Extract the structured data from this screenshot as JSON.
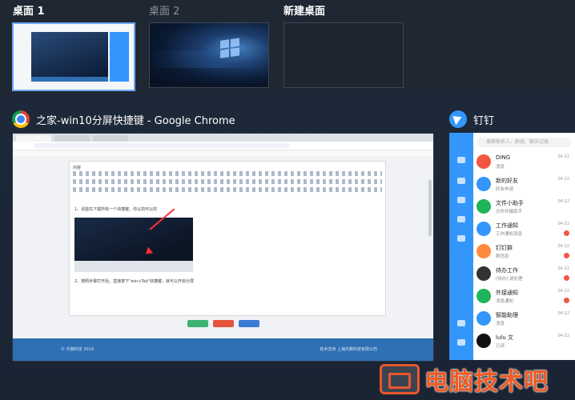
{
  "desktops": [
    {
      "label": "桌面 1",
      "active": true
    },
    {
      "label": "桌面 2",
      "active": false
    },
    {
      "label": "新建桌面",
      "active": false
    }
  ],
  "windows": {
    "chrome": {
      "title": "之家-win10分屏快捷键 - Google Chrome",
      "editor_heading": "内容",
      "step1": "1、请首先下载所有一个快捷键，你以前可以的",
      "step2": "2、按照步骤打开后，直接按下\"win+Tab\"快捷键，就可以开启分屏",
      "footer_left": "© 乐鹏科技 2019",
      "footer_right": "技术支持 上海乐鹏科技有限公司"
    },
    "dingtalk": {
      "title": "钉钉",
      "search_placeholder": "搜索联系人、群组、聊天记录",
      "items": [
        {
          "name": "DING",
          "msg": "消息",
          "time": "04-22",
          "color": "#f25643",
          "badge": false
        },
        {
          "name": "新的好友",
          "msg": "好友申请",
          "time": "04-22",
          "color": "#3296fa",
          "badge": false
        },
        {
          "name": "文件小助手",
          "msg": "文件传输助手",
          "time": "04-22",
          "color": "#1fb45a",
          "badge": false
        },
        {
          "name": "工作通知",
          "msg": "工作通知消息",
          "time": "04-22",
          "color": "#3296fa",
          "badge": true
        },
        {
          "name": "钉钉群",
          "msg": "群消息",
          "time": "04-22",
          "color": "#ff8a3d",
          "badge": true
        },
        {
          "name": "待办工作",
          "msg": "[待办] 请处理",
          "time": "04-22",
          "color": "#333333",
          "badge": true
        },
        {
          "name": "外接通知",
          "msg": "消息通知",
          "time": "04-22",
          "color": "#1fb45a",
          "badge": true
        },
        {
          "name": "智能助理",
          "msg": "消息",
          "time": "04-22",
          "color": "#3296fa",
          "badge": false
        },
        {
          "name": "lulu 文",
          "msg": "已读",
          "time": "04-22",
          "color": "#111111",
          "badge": false
        }
      ]
    }
  },
  "watermark": "电脑技术吧"
}
